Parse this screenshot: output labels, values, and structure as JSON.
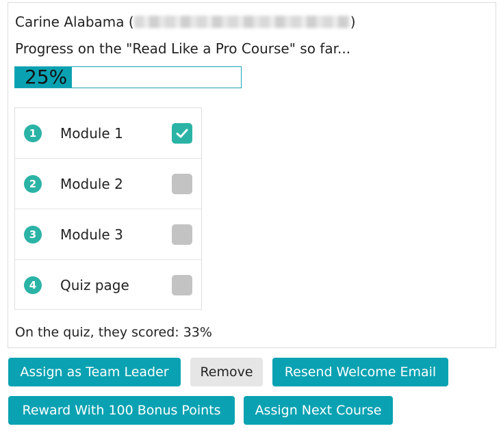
{
  "user": {
    "name_prefix": "Carine Alabama (",
    "name_suffix": ")"
  },
  "progress": {
    "text": "Progress on the \"Read Like a Pro Course\" so far...",
    "percent_label": "25%",
    "percent": 25
  },
  "modules": [
    {
      "number": "1",
      "label": "Module 1",
      "completed": true
    },
    {
      "number": "2",
      "label": "Module 2",
      "completed": false
    },
    {
      "number": "3",
      "label": "Module 3",
      "completed": false
    },
    {
      "number": "4",
      "label": "Quiz page",
      "completed": false
    }
  ],
  "quiz": {
    "score_text": "On the quiz, they scored: 33%"
  },
  "buttons": {
    "assign_leader": "Assign as Team Leader",
    "remove": "Remove",
    "resend_email": "Resend Welcome Email",
    "reward_points": "Reward With 100 Bonus Points",
    "assign_next": "Assign Next Course"
  },
  "colors": {
    "accent": "#0aa2b2",
    "teal_badge": "#2bb3a6",
    "unchecked": "#c3c3c3",
    "secondary_button": "#e6e6e6"
  }
}
